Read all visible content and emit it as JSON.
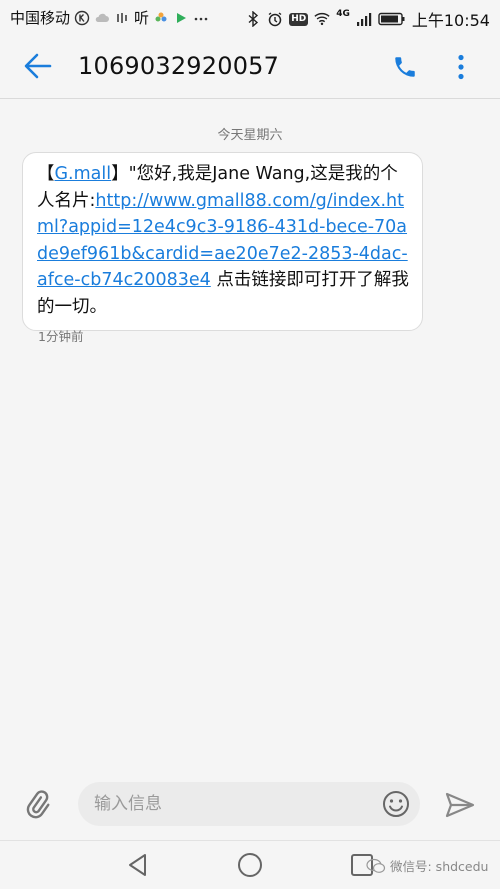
{
  "status_bar": {
    "carrier": "中国移动",
    "listen_label": "听",
    "network_label": "4G",
    "hd_label": "HD",
    "time": "上午10:54",
    "icons": [
      "k-icon",
      "cloud-icon",
      "headphone-icon",
      "flower-icon",
      "play-icon",
      "more-dots-icon",
      "bluetooth-icon",
      "alarm-icon",
      "hd-icon",
      "wifi-icon",
      "signal-icon",
      "battery-icon"
    ]
  },
  "header": {
    "title": "1069032920057",
    "back_icon": "arrow-left-icon",
    "call_icon": "phone-icon",
    "more_icon": "more-vertical-icon",
    "accent_color": "#1a7ddc"
  },
  "conversation": {
    "date_label": "今天星期六",
    "message": {
      "prefix": "【",
      "brand_link": "G.mall",
      "after_brand": "】\"您好,我是Jane Wang,这是我的个人名片:",
      "url": "http://www.gmall88.com/g/index.html?appid=12e4c9c3-9186-431d-bece-70ade9ef961b&cardid=ae20e7e2-2853-4dac-afce-cb74c20083e4",
      "suffix": " 点击链接即可打开了解我的一切。"
    },
    "time_label": "1分钟前"
  },
  "composer": {
    "placeholder": "输入信息",
    "attach_icon": "paperclip-icon",
    "emoji_icon": "smiley-icon",
    "send_icon": "send-icon"
  },
  "nav_bar": {
    "icons": [
      "triangle-back-icon",
      "circle-home-icon",
      "square-recent-icon"
    ],
    "watermark": "微信号: shdcedu"
  }
}
